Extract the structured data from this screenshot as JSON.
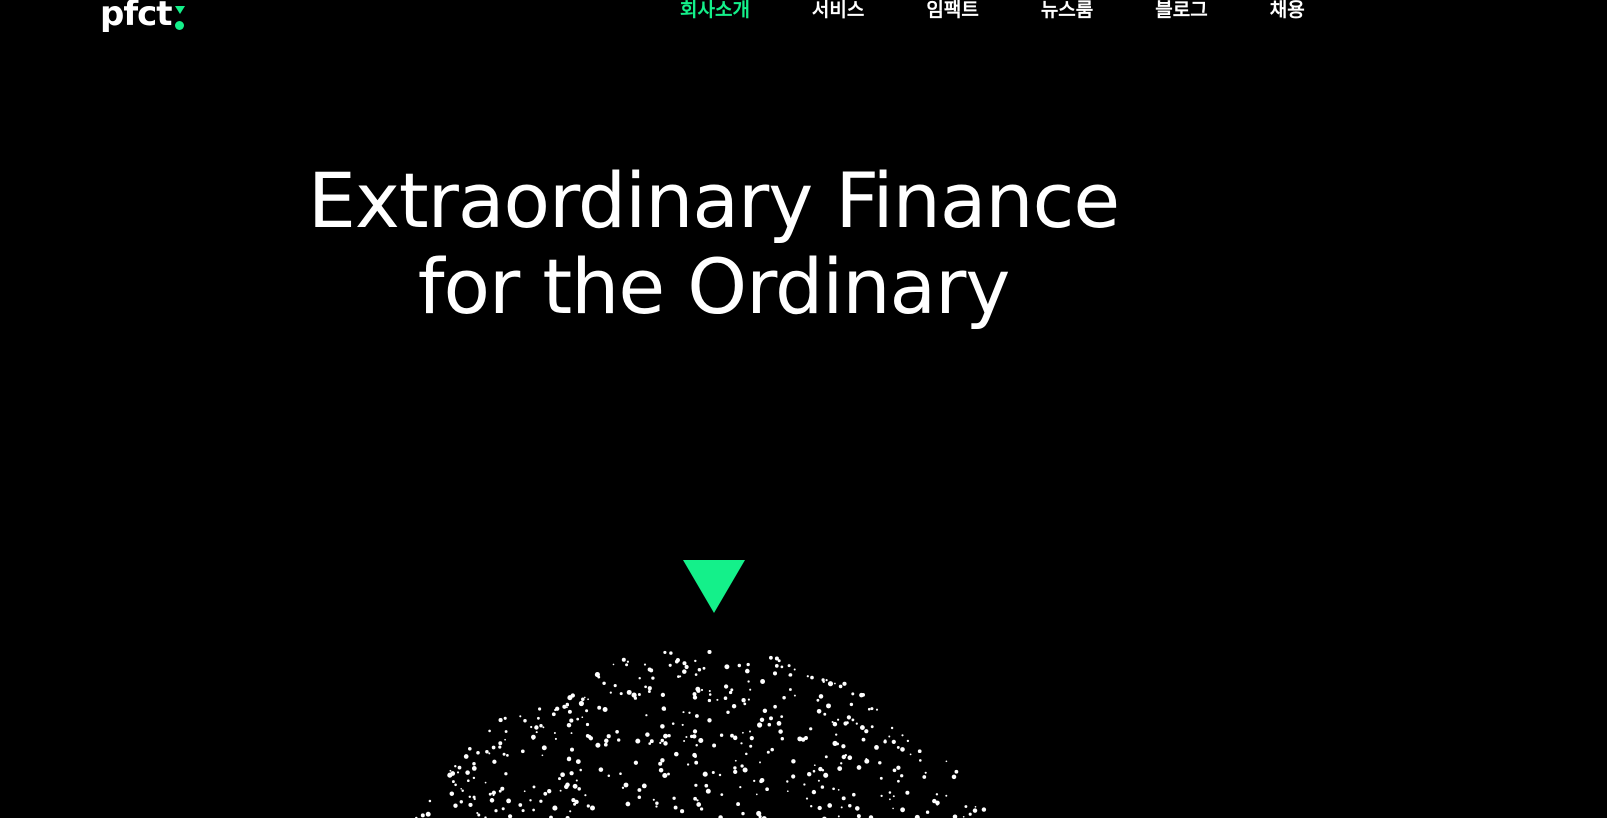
{
  "brand": {
    "name": "pfct",
    "accent_color": "#14f08a",
    "background_color": "#000000",
    "text_color": "#ffffff"
  },
  "nav": {
    "items": [
      {
        "label": "회사소개",
        "active": true
      },
      {
        "label": "서비스",
        "active": false
      },
      {
        "label": "임팩트",
        "active": false
      },
      {
        "label": "뉴스룸",
        "active": false
      },
      {
        "label": "블로그",
        "active": false
      },
      {
        "label": "채용",
        "active": false
      }
    ]
  },
  "hero": {
    "line1": "Extraordinary Finance",
    "line2": "for the Ordinary"
  },
  "scroll": {
    "icon": "triangle-down-icon"
  },
  "globe": {
    "icon": "particle-globe"
  }
}
